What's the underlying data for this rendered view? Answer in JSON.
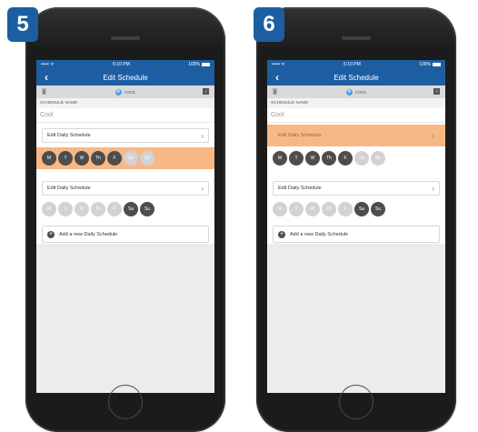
{
  "badges": {
    "left": "5",
    "right": "6"
  },
  "status_bar": {
    "carrier": "••••• ᯤ",
    "time": "6:10 PM",
    "battery": "100%"
  },
  "nav": {
    "title": "Edit Schedule",
    "back": "‹"
  },
  "mode": {
    "label": "COOL",
    "calendar": "7"
  },
  "schedule": {
    "label": "SCHEDULE NAME",
    "value": "Cool",
    "edit_daily": "Edit Daily Schedule",
    "add_new": "Add a new Daily Schedule",
    "chevron": "›"
  },
  "days": [
    "M",
    "T",
    "W",
    "Th",
    "F",
    "Sa",
    "Su"
  ],
  "colors": {
    "accent_blue": "#1d5ea3",
    "highlight": "#f8b885",
    "day_on": "#4d4d4d",
    "day_off": "#d2d2d6"
  },
  "selection": {
    "weekdays_active": [
      true,
      true,
      true,
      true,
      true,
      false,
      false
    ],
    "weekends_active": [
      false,
      false,
      false,
      false,
      false,
      true,
      true
    ]
  }
}
